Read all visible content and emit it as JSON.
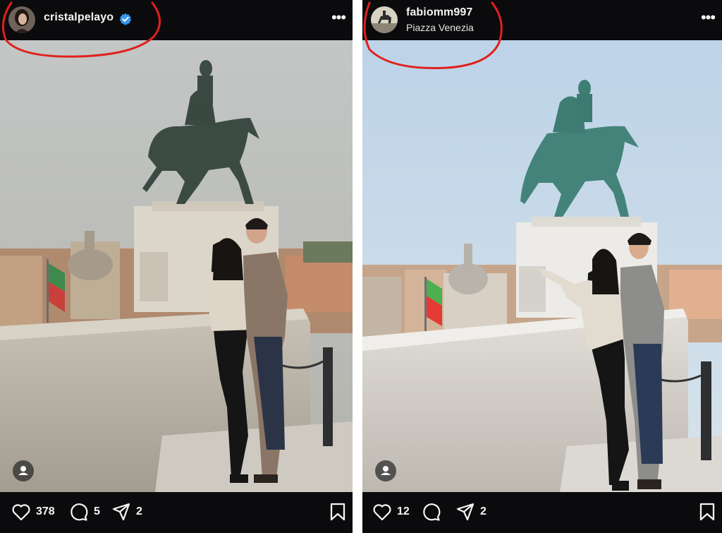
{
  "posts": [
    {
      "username": "cristalpelayo",
      "verified": true,
      "location": "",
      "likes": "378",
      "comments": "5",
      "shares": "2"
    },
    {
      "username": "fabiomm997",
      "verified": false,
      "location": "Piazza Venezia",
      "likes": "12",
      "comments": "",
      "shares": "2"
    }
  ],
  "icons": [
    "verified-badge-icon",
    "more-options-icon",
    "heart-icon",
    "comment-icon",
    "share-icon",
    "bookmark-icon",
    "user-tag-icon"
  ],
  "colors": {
    "background": "#0b0b0d",
    "verified": "#3897f0",
    "annotation": "#e0201c",
    "text": "#f5f5f5"
  }
}
